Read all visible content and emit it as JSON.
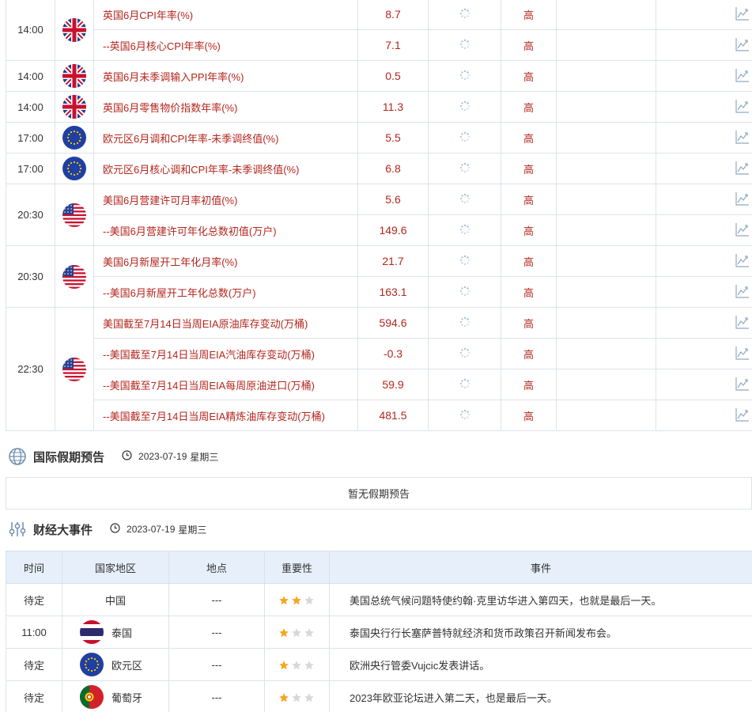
{
  "econ_groups": [
    {
      "time": "14:00",
      "flag": "uk-flag-icon",
      "rows": [
        {
          "name": "英国6月CPI年率(%)",
          "actual": "8.7",
          "importance": "高"
        },
        {
          "name": "--英国6月核心CPI年率(%)",
          "actual": "7.1",
          "importance": "高"
        }
      ]
    },
    {
      "time": "14:00",
      "flag": "uk-flag-icon",
      "rows": [
        {
          "name": "英国6月未季调输入PPI年率(%)",
          "actual": "0.5",
          "importance": "高"
        }
      ]
    },
    {
      "time": "14:00",
      "flag": "uk-flag-icon",
      "rows": [
        {
          "name": "英国6月零售物价指数年率(%)",
          "actual": "11.3",
          "importance": "高"
        }
      ]
    },
    {
      "time": "17:00",
      "flag": "eu-flag-icon",
      "rows": [
        {
          "name": "欧元区6月调和CPI年率-未季调终值(%)",
          "actual": "5.5",
          "importance": "高"
        }
      ]
    },
    {
      "time": "17:00",
      "flag": "eu-flag-icon",
      "rows": [
        {
          "name": "欧元区6月核心调和CPI年率-未季调终值(%)",
          "actual": "6.8",
          "importance": "高"
        }
      ]
    },
    {
      "time": "20:30",
      "flag": "us-flag-icon",
      "rows": [
        {
          "name": "美国6月营建许可月率初值(%)",
          "actual": "5.6",
          "importance": "高"
        },
        {
          "name": "--美国6月营建许可年化总数初值(万户)",
          "actual": "149.6",
          "importance": "高"
        }
      ]
    },
    {
      "time": "20:30",
      "flag": "us-flag-icon",
      "rows": [
        {
          "name": "美国6月新屋开工年化月率(%)",
          "actual": "21.7",
          "importance": "高"
        },
        {
          "name": "--美国6月新屋开工年化总数(万户)",
          "actual": "163.1",
          "importance": "高"
        }
      ]
    },
    {
      "time": "22:30",
      "flag": "us-flag-icon",
      "rows": [
        {
          "name": "美国截至7月14日当周EIA原油库存变动(万桶)",
          "actual": "594.6",
          "importance": "高"
        },
        {
          "name": "--美国截至7月14日当周EIA汽油库存变动(万桶)",
          "actual": "-0.3",
          "importance": "高"
        },
        {
          "name": "--美国截至7月14日当周EIA每周原油进口(万桶)",
          "actual": "59.9",
          "importance": "高"
        },
        {
          "name": "--美国截至7月14日当周EIA精炼油库存变动(万桶)",
          "actual": "481.5",
          "importance": "高"
        }
      ]
    }
  ],
  "holiday": {
    "title": "国际假期预告",
    "date": "2023-07-19",
    "weekday": "星期三",
    "empty_text": "暂无假期预告"
  },
  "events": {
    "title": "财经大事件",
    "date": "2023-07-19",
    "weekday": "星期三",
    "headers": [
      "时间",
      "国家地区",
      "地点",
      "重要性",
      "事件"
    ],
    "rows": [
      {
        "time": "待定",
        "country": "中国",
        "flag": "",
        "place": "---",
        "stars": 2,
        "event": "美国总统气候问题特使约翰·克里访华进入第四天，也就是最后一天。"
      },
      {
        "time": "11:00",
        "country": "泰国",
        "flag": "thailand-flag-icon",
        "place": "---",
        "stars": 1,
        "event": "泰国央行行长塞萨普特就经济和货币政策召开新闻发布会。"
      },
      {
        "time": "待定",
        "country": "欧元区",
        "flag": "eu-flag-icon",
        "place": "---",
        "stars": 1,
        "event": "欧洲央行管委Vujcic发表讲话。"
      },
      {
        "time": "待定",
        "country": "葡萄牙",
        "flag": "portugal-flag-icon",
        "place": "---",
        "stars": 1,
        "event": "2023年欧亚论坛进入第二天，也是最后一天。"
      }
    ]
  },
  "colors": {
    "highlight_red": "#b3261e",
    "header_bg": "#e7f0fa",
    "border": "#dde3ea",
    "star_on": "#f5a623",
    "star_off": "#d8d8d8"
  }
}
